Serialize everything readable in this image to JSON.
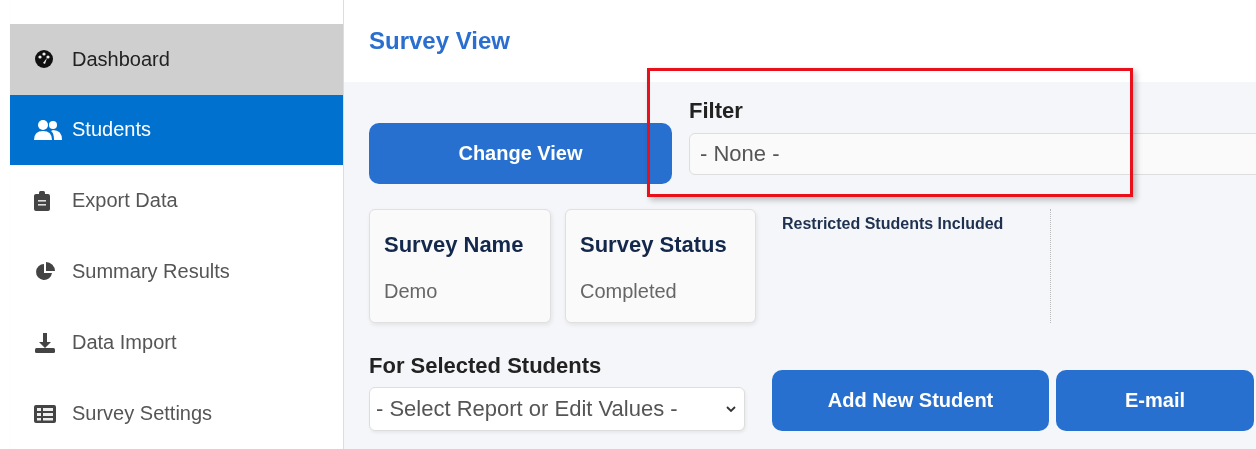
{
  "sidebar": {
    "items": [
      {
        "label": "Dashboard",
        "kind": "gauge",
        "selected": false,
        "highlighted": true
      },
      {
        "label": "Students",
        "kind": "users",
        "selected": true,
        "highlighted": false
      },
      {
        "label": "Export Data",
        "kind": "clipboard",
        "selected": false,
        "highlighted": false
      },
      {
        "label": "Summary Results",
        "kind": "pie",
        "selected": false,
        "highlighted": false
      },
      {
        "label": "Data Import",
        "kind": "download",
        "selected": false,
        "highlighted": false
      },
      {
        "label": "Survey Settings",
        "kind": "table",
        "selected": false,
        "highlighted": false
      }
    ]
  },
  "page_title": "Survey View",
  "change_view_button": "Change View",
  "filter": {
    "label": "Filter",
    "value": "- None -",
    "highlighted": true
  },
  "cards": [
    {
      "title": "Survey Name",
      "value": "Demo"
    },
    {
      "title": "Survey Status",
      "value": "Completed"
    }
  ],
  "restricted_note": "Restricted Students Included",
  "selected_students": {
    "label": "For Selected Students",
    "value": "- Select Report or Edit Values -"
  },
  "buttons": [
    "Add New Student",
    "E-mail"
  ]
}
